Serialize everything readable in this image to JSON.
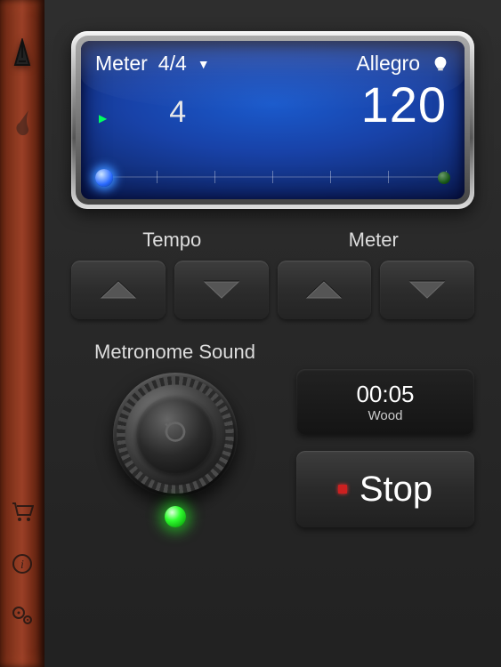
{
  "sidebar": {
    "icons": [
      "metronome",
      "guitar",
      "cart",
      "info",
      "settings"
    ]
  },
  "display": {
    "meter_label": "Meter",
    "meter_value": "4/4",
    "tempo_name": "Allegro",
    "beat_count": "4",
    "bpm": "120"
  },
  "controls": {
    "tempo_label": "Tempo",
    "meter_label": "Meter",
    "sound_label": "Metronome Sound"
  },
  "timer": {
    "value": "00:05",
    "sound_name": "Wood"
  },
  "transport": {
    "stop_label": "Stop"
  },
  "colors": {
    "accent_blue": "#1a5acc",
    "led_green": "#30ff30",
    "wood": "#7a2e18"
  }
}
